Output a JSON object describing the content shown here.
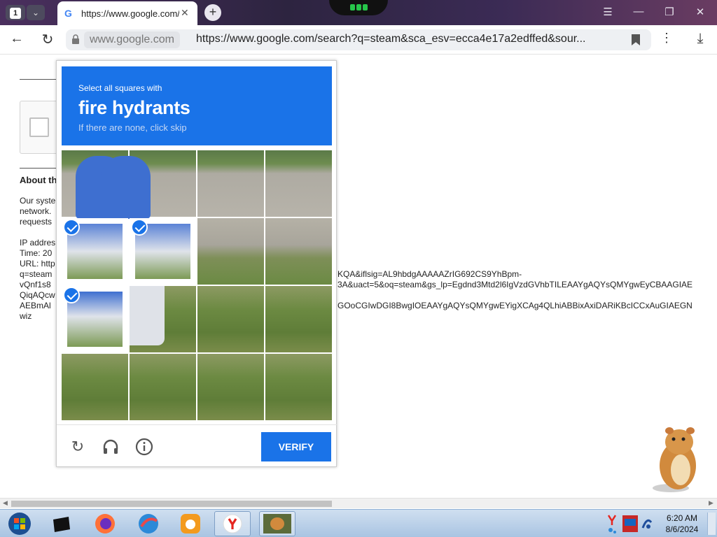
{
  "browser": {
    "tab_count": "1",
    "tab_title": "https://www.google.com/search?q=steam",
    "domain": "www.google.com",
    "url": "https://www.google.com/search?q=steam&sca_esv=ecca4e17a2edffed&sour..."
  },
  "page": {
    "about_heading": "About th",
    "lines_1": [
      "Our syste",
      "network.",
      "requests"
    ],
    "lines_2": [
      "IP addres",
      "Time: 20",
      "URL: http",
      "q=steam",
      "vQnf1s8",
      "QiqAQcw",
      "AEBmAl",
      "wiz"
    ],
    "url_lines": [
      "KQA&iflsig=AL9hbdgAAAAAZrIG692CS9YhBpm-",
      "3A&uact=5&oq=steam&gs_lp=Egdnd3Mtd2l6IgVzdGVhbTILEAAYgAQYsQMYgwEyCBAAGIAE",
      "",
      "GOoCGIwDGI8BwgIOEAAYgAQYsQMYgwEYigXCAg4QLhiABBixAxiDARiKBcICCxAuGIAEGN"
    ]
  },
  "challenge": {
    "instruction": "Select all squares with",
    "object": "fire hydrants",
    "hint": "If there are none, click skip",
    "verify_label": "VERIFY",
    "selected_tiles": [
      4,
      5,
      8
    ]
  },
  "taskbar": {
    "time": "6:20 AM",
    "date": "8/6/2024"
  },
  "colors": {
    "accent": "#1a73e8",
    "taskbar": "#a9c4e2"
  }
}
